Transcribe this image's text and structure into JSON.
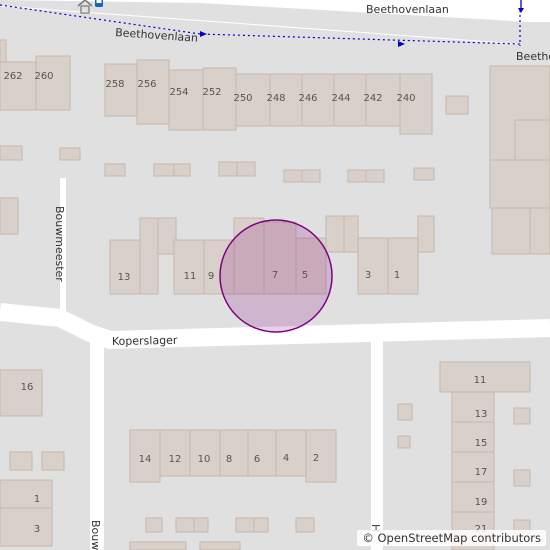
{
  "map": {
    "streets": {
      "beethovenlaan_top": "Beethovenlaan",
      "beethovenlaan_path": "Beethovenlaan",
      "beethovenlaan_right": "Beetho",
      "bouwmeester_top": "Bouwmeester",
      "bouwmeester_bottom": "Bouw",
      "koperslager": "Koperslager",
      "h_street": "H"
    },
    "house_numbers": {
      "n262": "262",
      "n260": "260",
      "n258": "258",
      "n256": "256",
      "n254": "254",
      "n252": "252",
      "n250": "250",
      "n248": "248",
      "n246": "246",
      "n244": "244",
      "n242": "242",
      "n240": "240",
      "n13a": "13",
      "n11a": "11",
      "n9": "9",
      "n7": "7",
      "n5": "5",
      "n3a": "3",
      "n1a": "1",
      "n16": "16",
      "n14": "14",
      "n12": "12",
      "n10": "10",
      "n8": "8",
      "n6": "6",
      "n4": "4",
      "n2": "2",
      "n1b": "1",
      "n3b": "3",
      "n11b": "11",
      "n13b": "13",
      "n15": "15",
      "n17": "17",
      "n19": "19",
      "n21": "21"
    },
    "highlight_color": "#800080"
  },
  "attribution": "© OpenStreetMap contributors"
}
